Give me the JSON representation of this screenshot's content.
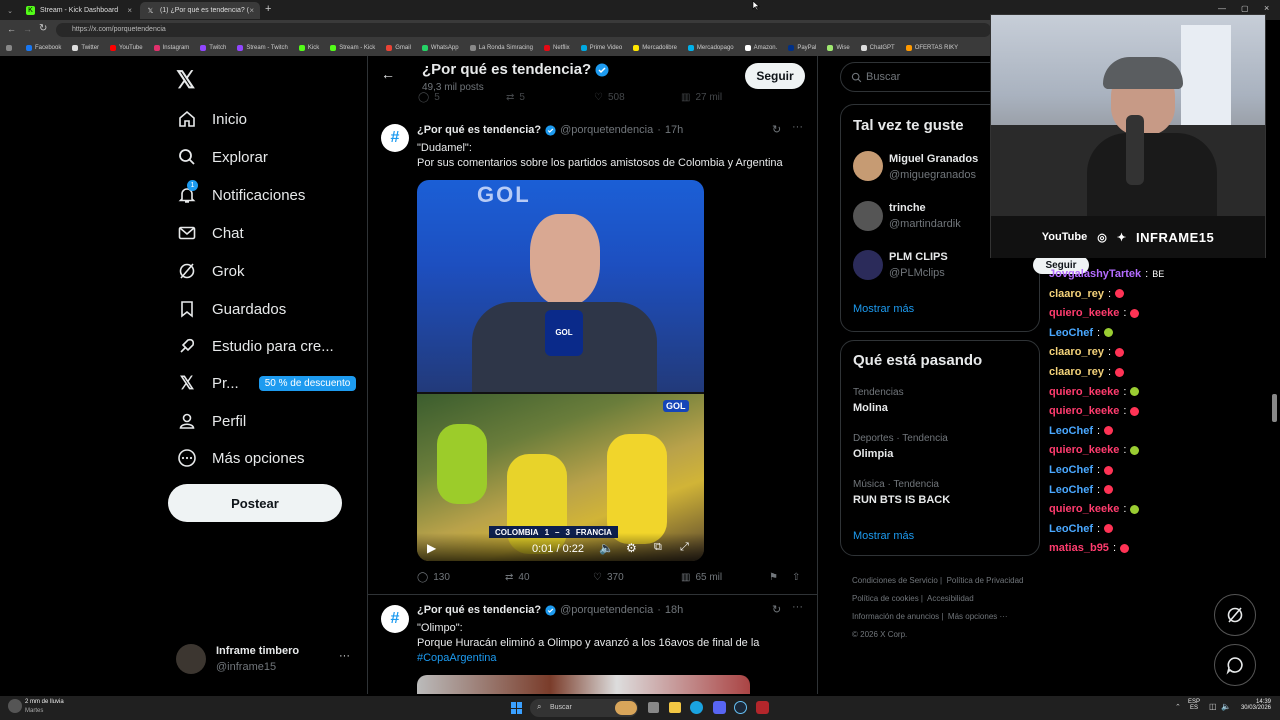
{
  "browser": {
    "tabs": [
      {
        "title": "Stream - Kick Dashboard"
      },
      {
        "title": "(1) ¿Por qué es tendencia? (@porq..."
      }
    ],
    "new_tab_label": "+",
    "url": "https://x.com/porquetendencia",
    "bookmarks": [
      "Facebook",
      "Twitter",
      "YouTube",
      "Instagram",
      "Twitch",
      "Stream - Twitch",
      "Kick",
      "Stream - Kick",
      "Gmail",
      "WhatsApp",
      "La Ronda Simracing",
      "Netflix",
      "Prime Video",
      "Mercadolibre",
      "Mercadopago",
      "Amazon.",
      "PayPal",
      "Wise",
      "ChatGPT",
      "OFERTAS RIKY"
    ]
  },
  "sidebar": {
    "items": [
      {
        "label": "Inicio"
      },
      {
        "label": "Explorar"
      },
      {
        "label": "Notificaciones",
        "badge": "1"
      },
      {
        "label": "Chat"
      },
      {
        "label": "Grok"
      },
      {
        "label": "Guardados"
      },
      {
        "label": "Estudio para cre..."
      },
      {
        "label": "Pr...",
        "promo": "50 % de descuento"
      },
      {
        "label": "Perfil"
      },
      {
        "label": "Más opciones"
      }
    ],
    "post_button": "Postear",
    "account": {
      "name": "Inframe timbero",
      "handle": "@inframe15"
    }
  },
  "profile_header": {
    "title": "¿Por qué es tendencia?",
    "posts": "49,3 mil posts",
    "follow": "Seguir"
  },
  "prev_tweet_actions": {
    "replies": "5",
    "reposts": "5",
    "likes": "508",
    "views": "27 mil"
  },
  "tweets": [
    {
      "name": "¿Por qué es tendencia?",
      "handle": "@porquetendencia",
      "time": "17h",
      "line1": "\"Dudamel\":",
      "line2": "Por sus comentarios sobre los partidos amistosos de Colombia y Argentina",
      "video_time": "0:01 / 0:22",
      "scoreboard": {
        "team1": "COLOMBIA",
        "score1": "1",
        "score2": "3",
        "team2": "FRANCIA"
      },
      "actions": {
        "replies": "130",
        "reposts": "40",
        "likes": "370",
        "views": "65 mil"
      }
    },
    {
      "name": "¿Por qué es tendencia?",
      "handle": "@porquetendencia",
      "time": "18h",
      "line1": "\"Olimpo\":",
      "line2": "Porque Huracán eliminó a Olimpo y avanzó a los 16avos de final de la",
      "hashtag": "#CopaArgentina"
    }
  ],
  "search": {
    "placeholder": "Buscar"
  },
  "who_to_follow": {
    "title": "Tal vez te guste",
    "users": [
      {
        "name": "Miguel Granados",
        "handle": "@miguegranados"
      },
      {
        "name": "trinche",
        "handle": "@martindardik"
      },
      {
        "name": "PLM CLIPS",
        "handle": "@PLMclips"
      }
    ],
    "show_more": "Mostrar más"
  },
  "trends": {
    "title": "Qué está pasando",
    "items": [
      {
        "context": "Tendencias",
        "name": "Molina"
      },
      {
        "context": "Deportes · Tendencia",
        "name": "Olimpia"
      },
      {
        "context": "Música · Tendencia",
        "name": "RUN BTS IS BACK"
      }
    ],
    "show_more": "Mostrar más"
  },
  "footer_links": [
    "Condiciones de Servicio",
    "Política de Privacidad",
    "Política de cookies",
    "Accesibilidad",
    "Información de anuncios",
    "Más opciones ···",
    "© 2026 X Corp."
  ],
  "webcam": {
    "socials": "YouTube",
    "handle": "INFRAME15"
  },
  "chat": {
    "follow_button": "Seguir",
    "messages": [
      {
        "user": "JovgalashyTartek",
        "text": "BE",
        "color": "#b36cff"
      },
      {
        "user": "claaro_rey",
        "text": "",
        "color": "#f4d27a"
      },
      {
        "user": "quiero_keeke",
        "text": "",
        "color": "#ff3c6e"
      },
      {
        "user": "LeoChef",
        "text": "",
        "color": "#4aa8ff"
      },
      {
        "user": "claaro_rey",
        "text": "",
        "color": "#f4d27a"
      },
      {
        "user": "claaro_rey",
        "text": "",
        "color": "#f4d27a"
      },
      {
        "user": "quiero_keeke",
        "text": "",
        "color": "#ff3c6e"
      },
      {
        "user": "quiero_keeke",
        "text": "",
        "color": "#ff3c6e"
      },
      {
        "user": "LeoChef",
        "text": "",
        "color": "#4aa8ff"
      },
      {
        "user": "quiero_keeke",
        "text": "",
        "color": "#ff3c6e"
      },
      {
        "user": "LeoChef",
        "text": "",
        "color": "#4aa8ff"
      },
      {
        "user": "LeoChef",
        "text": "",
        "color": "#4aa8ff"
      },
      {
        "user": "quiero_keeke",
        "text": "",
        "color": "#ff3c6e"
      },
      {
        "user": "LeoChef",
        "text": "",
        "color": "#4aa8ff"
      },
      {
        "user": "matias_b95",
        "text": "",
        "color": "#ff3c6e"
      }
    ]
  },
  "taskbar": {
    "weather": "2 mm de lluvia",
    "weather_sub": "Martes",
    "search": "Buscar",
    "lang": "ESP",
    "lang_sub": "ES",
    "time": "14:39",
    "date": "30/03/2026"
  },
  "colors": {
    "accent": "#1d9bf0",
    "bg": "#000000",
    "border": "#2f3336"
  }
}
